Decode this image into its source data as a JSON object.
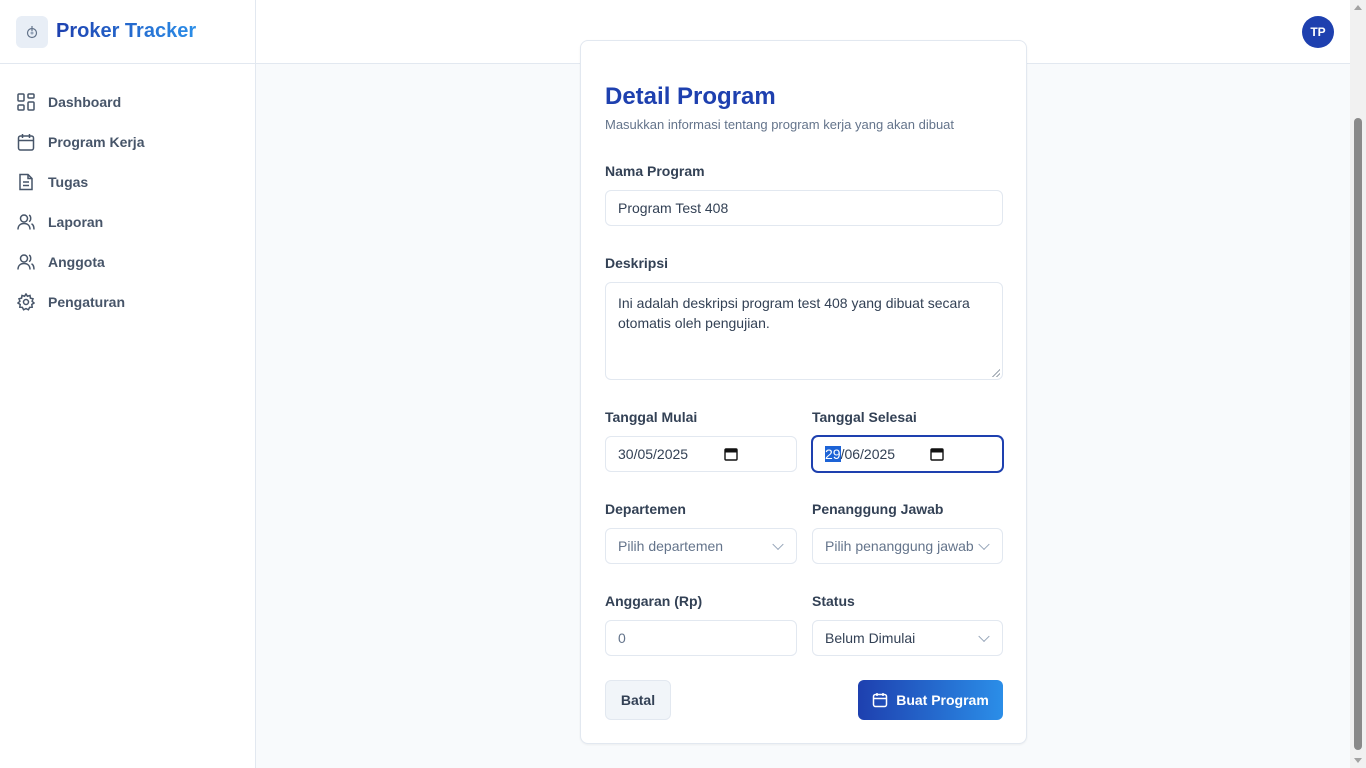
{
  "app": {
    "title": "Proker Tracker",
    "avatar_initials": "TP",
    "accent_color": "#1e40af"
  },
  "sidebar": {
    "items": [
      {
        "label": "Dashboard",
        "icon": "dashboard-icon"
      },
      {
        "label": "Program Kerja",
        "icon": "calendar-icon"
      },
      {
        "label": "Tugas",
        "icon": "document-icon"
      },
      {
        "label": "Laporan",
        "icon": "users-icon"
      },
      {
        "label": "Anggota",
        "icon": "users-icon"
      },
      {
        "label": "Pengaturan",
        "icon": "gear-icon"
      }
    ]
  },
  "form": {
    "title": "Detail Program",
    "subtitle": "Masukkan informasi tentang program kerja yang akan dibuat",
    "nama_label": "Nama Program",
    "nama_value": "Program Test 408",
    "deskripsi_label": "Deskripsi",
    "deskripsi_value": "Ini adalah deskripsi program test 408 yang dibuat secara otomatis oleh pengujian.",
    "mulai_label": "Tanggal Mulai",
    "mulai_value": "30/05/2025",
    "selesai_label": "Tanggal Selesai",
    "selesai_day": "29",
    "selesai_rest": "/06/2025",
    "departemen_label": "Departemen",
    "departemen_placeholder": "Pilih departemen",
    "pj_label": "Penanggung Jawab",
    "pj_placeholder": "Pilih penanggung jawab",
    "anggaran_label": "Anggaran (Rp)",
    "anggaran_value": "0",
    "status_label": "Status",
    "status_value": "Belum Dimulai",
    "cancel_label": "Batal",
    "submit_label": "Buat Program"
  }
}
